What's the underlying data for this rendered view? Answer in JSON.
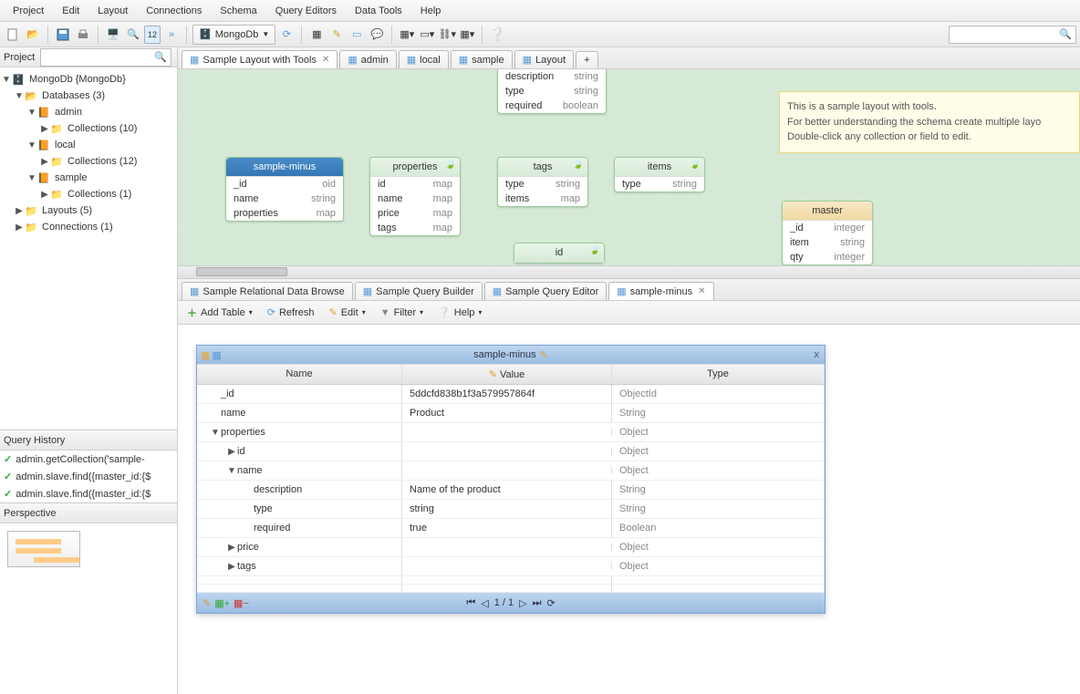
{
  "menubar": [
    "Project",
    "Edit",
    "Layout",
    "Connections",
    "Schema",
    "Query Editors",
    "Data Tools",
    "Help"
  ],
  "db_selector": "MongoDb",
  "left": {
    "title": "Project",
    "tree": [
      {
        "indent": 0,
        "toggle": "▼",
        "icon": "db",
        "label": "MongoDb {MongoDb}"
      },
      {
        "indent": 1,
        "toggle": "▼",
        "icon": "folder-open",
        "label": "Databases (3)"
      },
      {
        "indent": 2,
        "toggle": "▼",
        "icon": "book",
        "label": "admin"
      },
      {
        "indent": 3,
        "toggle": "▶",
        "icon": "folder",
        "label": "Collections (10)"
      },
      {
        "indent": 2,
        "toggle": "▼",
        "icon": "book",
        "label": "local"
      },
      {
        "indent": 3,
        "toggle": "▶",
        "icon": "folder",
        "label": "Collections (12)"
      },
      {
        "indent": 2,
        "toggle": "▼",
        "icon": "book",
        "label": "sample"
      },
      {
        "indent": 3,
        "toggle": "▶",
        "icon": "folder",
        "label": "Collections (1)"
      },
      {
        "indent": 1,
        "toggle": "▶",
        "icon": "folder",
        "label": "Layouts (5)"
      },
      {
        "indent": 1,
        "toggle": "▶",
        "icon": "folder",
        "label": "Connections (1)"
      }
    ],
    "qh_title": "Query History",
    "qh_items": [
      "admin.getCollection('sample-",
      "admin.slave.find({master_id:{$",
      "admin.slave.find({master_id:{$"
    ],
    "persp_title": "Perspective"
  },
  "main_tabs": [
    {
      "icon": "layout",
      "label": "Sample Layout with Tools",
      "close": true,
      "active": true
    },
    {
      "icon": "layout",
      "label": "admin"
    },
    {
      "icon": "layout",
      "label": "local"
    },
    {
      "icon": "layout",
      "label": "sample"
    },
    {
      "icon": "layout",
      "label": "Layout"
    }
  ],
  "note": {
    "l1": "This is a sample layout with tools.",
    "l2": "For better understanding the schema create multiple layo",
    "l3": "Double-click any collection or field to edit."
  },
  "entities": {
    "desc": {
      "rows": [
        [
          "description",
          "string"
        ],
        [
          "type",
          "string"
        ],
        [
          "required",
          "boolean"
        ]
      ]
    },
    "sample_minus": {
      "title": "sample-minus",
      "rows": [
        [
          "_id",
          "oid"
        ],
        [
          "name",
          "string"
        ],
        [
          "properties",
          "map"
        ]
      ]
    },
    "properties": {
      "title": "properties",
      "rows": [
        [
          "id",
          "map"
        ],
        [
          "name",
          "map"
        ],
        [
          "price",
          "map"
        ],
        [
          "tags",
          "map"
        ]
      ]
    },
    "tags": {
      "title": "tags",
      "rows": [
        [
          "type",
          "string"
        ],
        [
          "items",
          "map"
        ]
      ]
    },
    "items": {
      "title": "items",
      "rows": [
        [
          "type",
          "string"
        ]
      ]
    },
    "id": {
      "title": "id"
    },
    "master": {
      "title": "master",
      "rows": [
        [
          "_id",
          "integer"
        ],
        [
          "item",
          "string"
        ],
        [
          "qty",
          "integer"
        ]
      ]
    }
  },
  "sub_tabs": [
    {
      "label": "Sample Relational Data Browse"
    },
    {
      "label": "Sample Query Builder"
    },
    {
      "label": "Sample Query Editor"
    },
    {
      "label": "sample-minus",
      "close": true,
      "active": true
    }
  ],
  "sub_toolbar": {
    "add_table": "Add Table",
    "refresh": "Refresh",
    "edit": "Edit",
    "filter": "Filter",
    "help": "Help"
  },
  "grid": {
    "title": "sample-minus",
    "headers": {
      "name": "Name",
      "value": "Value",
      "type": "Type"
    },
    "rows": [
      {
        "pad": 0,
        "exp": "",
        "name": "_id",
        "value": "5ddcfd838b1f3a579957864f",
        "type": "ObjectId"
      },
      {
        "pad": 0,
        "exp": "",
        "name": "name",
        "value": "Product",
        "type": "String"
      },
      {
        "pad": 0,
        "exp": "▼",
        "name": "properties",
        "value": "",
        "type": "Object"
      },
      {
        "pad": 1,
        "exp": "▶",
        "name": "id",
        "value": "",
        "type": "Object"
      },
      {
        "pad": 1,
        "exp": "▼",
        "name": "name",
        "value": "",
        "type": "Object"
      },
      {
        "pad": 2,
        "exp": "",
        "name": "description",
        "value": "Name of the product",
        "type": "String"
      },
      {
        "pad": 2,
        "exp": "",
        "name": "type",
        "value": "string",
        "type": "String"
      },
      {
        "pad": 2,
        "exp": "",
        "name": "required",
        "value": "true",
        "type": "Boolean"
      },
      {
        "pad": 1,
        "exp": "▶",
        "name": "price",
        "value": "",
        "type": "Object"
      },
      {
        "pad": 1,
        "exp": "▶",
        "name": "tags",
        "value": "",
        "type": "Object"
      },
      {
        "pad": 0,
        "exp": "",
        "name": "",
        "value": "",
        "type": ""
      },
      {
        "pad": 0,
        "exp": "",
        "name": "",
        "value": "",
        "type": ""
      }
    ],
    "pager": "1 / 1"
  }
}
